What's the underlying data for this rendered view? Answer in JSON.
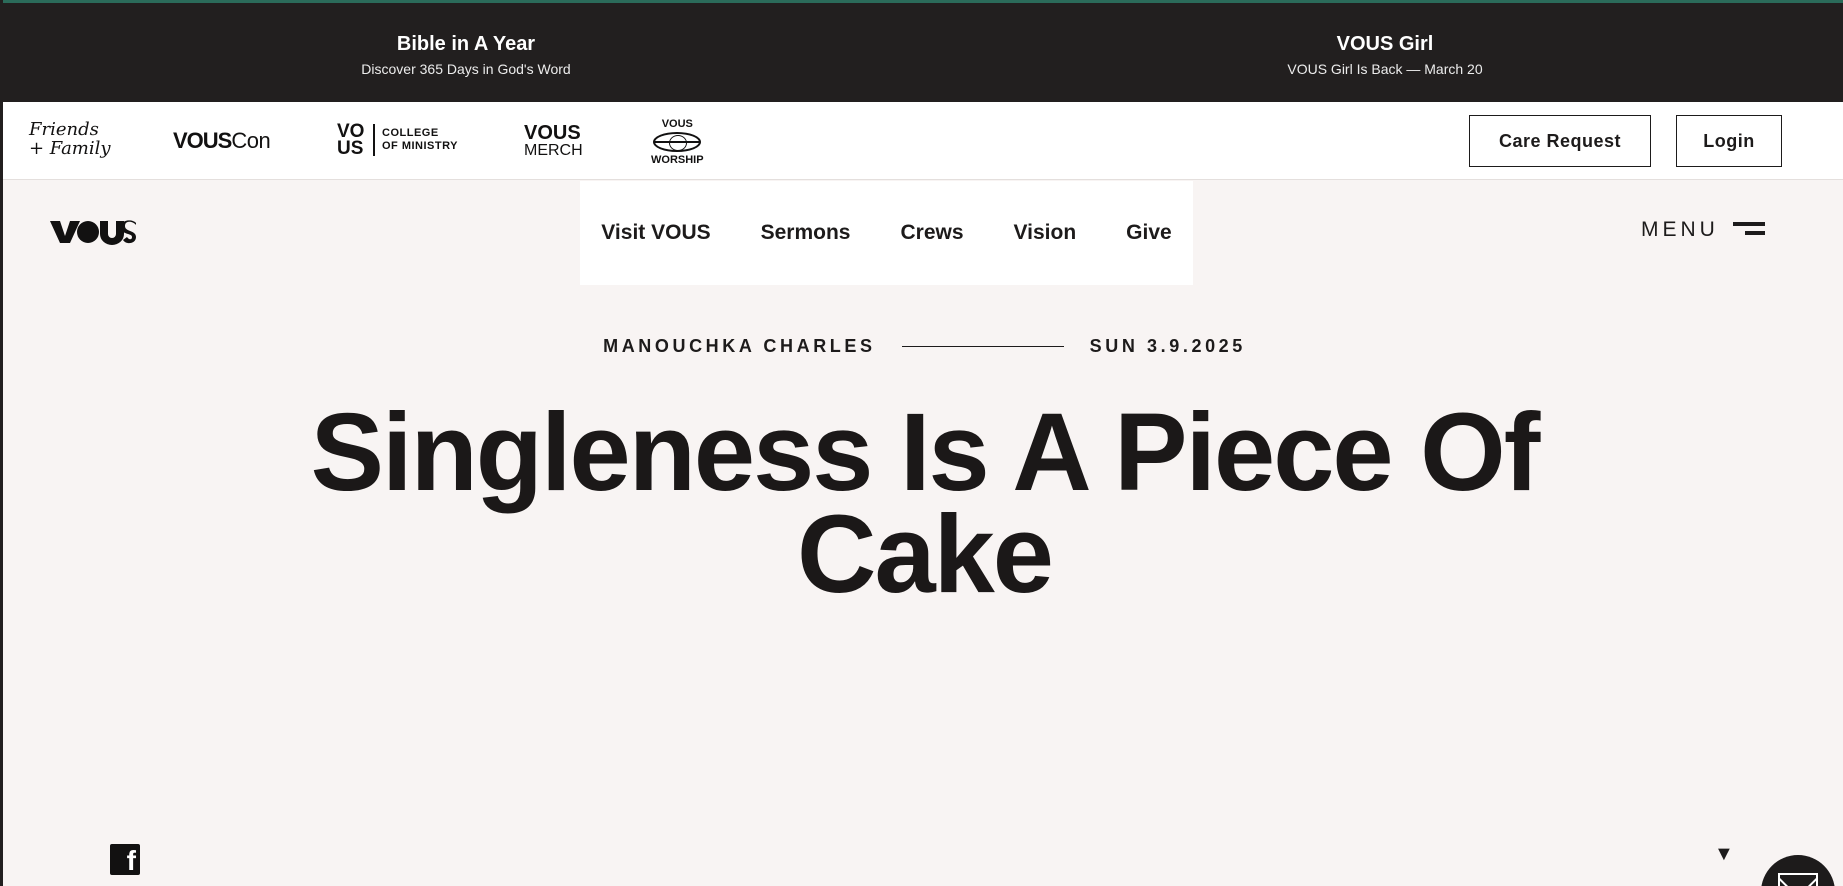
{
  "promo": {
    "left": {
      "title": "Bible in A Year",
      "subtitle": "Discover 365 Days in God's Word"
    },
    "right": {
      "title": "VOUS Girl",
      "subtitle": "VOUS Girl Is Back — March 20"
    }
  },
  "brand_strip": {
    "friends_family_line1": "Friends",
    "friends_family_line2": "+ Family",
    "vouscon_bold": "VOUS",
    "vouscon_rest": "Con",
    "college_mark_line1": "VO",
    "college_mark_line2": "US",
    "college_line1": "COLLEGE",
    "college_line2": "OF MINISTRY",
    "merch_line1": "VOUS",
    "merch_line2": "MERCH",
    "worship_line1": "VOUS",
    "worship_line2": "WORSHIP",
    "care_request_label": "Care Request",
    "login_label": "Login"
  },
  "nav": {
    "logo": "VOUS",
    "links": [
      "Visit VOUS",
      "Sermons",
      "Crews",
      "Vision",
      "Give"
    ],
    "menu_label": "MENU"
  },
  "article": {
    "author": "MANOUCHKA CHARLES",
    "date": "SUN 3.9.2025",
    "title": "Singleness Is A Piece Of Cake"
  },
  "footer": {
    "facebook_glyph": "f",
    "scroll_glyph": "▼"
  },
  "icons": {
    "logo": "vous-logo-icon",
    "menu": "hamburger-icon",
    "social": "facebook-icon",
    "scroll": "down-arrow-icon",
    "contact": "envelope-icon"
  },
  "colors": {
    "dark": "#221f1f",
    "page_background": "#f8f4f3",
    "text": "#1d1b1b",
    "accent_top": "#2b6b5a"
  }
}
